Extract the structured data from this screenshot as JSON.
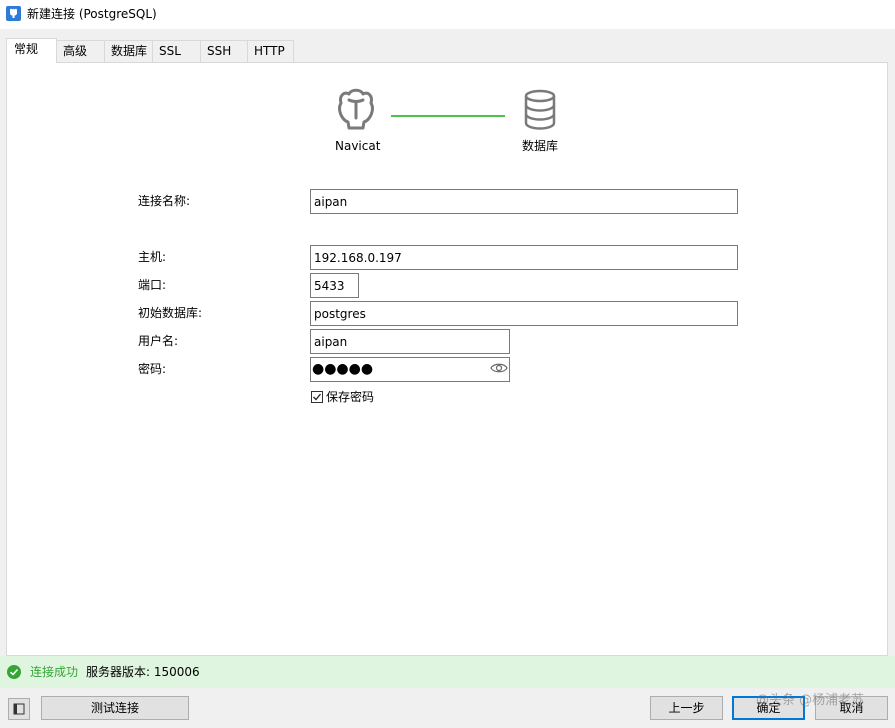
{
  "window": {
    "title": "新建连接 (PostgreSQL)",
    "app_icon": "navicat-app-icon"
  },
  "tabs": [
    {
      "label": "常规",
      "active": true
    },
    {
      "label": "高级",
      "active": false
    },
    {
      "label": "数据库",
      "active": false
    },
    {
      "label": "SSL",
      "active": false
    },
    {
      "label": "SSH",
      "active": false
    },
    {
      "label": "HTTP",
      "active": false
    }
  ],
  "flow": {
    "left_label": "Navicat",
    "right_label": "数据库",
    "left_icon": "navicat-seal-icon",
    "right_icon": "database-icon",
    "connector_color": "#4fc14f"
  },
  "form": {
    "connection_name_label": "连接名称:",
    "connection_name_value": "aipan",
    "host_label": "主机:",
    "host_value": "192.168.0.197",
    "port_label": "端口:",
    "port_value": "5433",
    "initial_db_label": "初始数据库:",
    "initial_db_value": "postgres",
    "username_label": "用户名:",
    "username_value": "aipan",
    "password_label": "密码:",
    "password_mask": "●●●●●",
    "save_password_label": "保存密码",
    "save_password_checked": true
  },
  "status": {
    "icon": "success-check-icon",
    "message": "连接成功",
    "server_version": "服务器版本: 150006",
    "color": "#35a535"
  },
  "buttons": {
    "test_connection": "测试连接",
    "previous": "上一步",
    "ok": "确定",
    "cancel": "取消"
  },
  "watermark": "@头条 @杨浦老苏",
  "colors": {
    "accent": "#0078d7",
    "success": "#35a535"
  }
}
